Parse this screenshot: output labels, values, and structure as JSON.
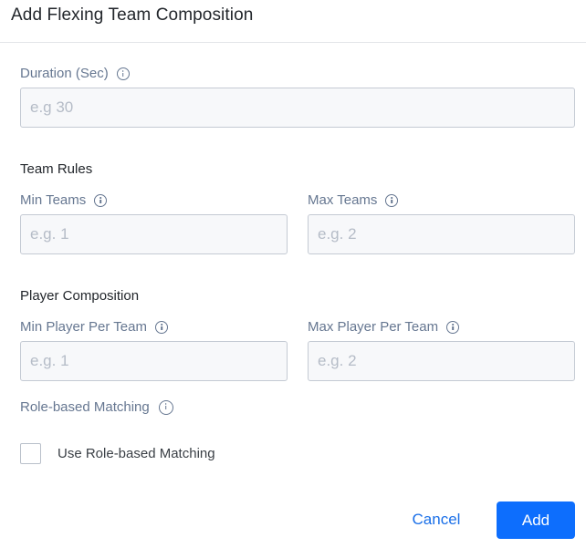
{
  "dialog": {
    "title": "Add Flexing Team Composition"
  },
  "duration": {
    "label": "Duration (Sec)",
    "value": "",
    "placeholder": "e.g 30"
  },
  "team_rules": {
    "heading": "Team Rules",
    "min_teams": {
      "label": "Min Teams",
      "value": "",
      "placeholder": "e.g. 1"
    },
    "max_teams": {
      "label": "Max Teams",
      "value": "",
      "placeholder": "e.g. 2"
    }
  },
  "player_composition": {
    "heading": "Player Composition",
    "min_player": {
      "label": "Min Player Per Team",
      "value": "",
      "placeholder": "e.g. 1"
    },
    "max_player": {
      "label": "Max Player Per Team",
      "value": "",
      "placeholder": "e.g. 2"
    }
  },
  "role_matching": {
    "label": "Role-based Matching",
    "checkbox_label": "Use Role-based Matching",
    "checked": false
  },
  "footer": {
    "cancel_label": "Cancel",
    "add_label": "Add"
  },
  "colors": {
    "primary": "#0d6efd",
    "link": "#1a6fe8",
    "label": "#667791"
  },
  "icons": {
    "info": "info-circle-icon"
  }
}
